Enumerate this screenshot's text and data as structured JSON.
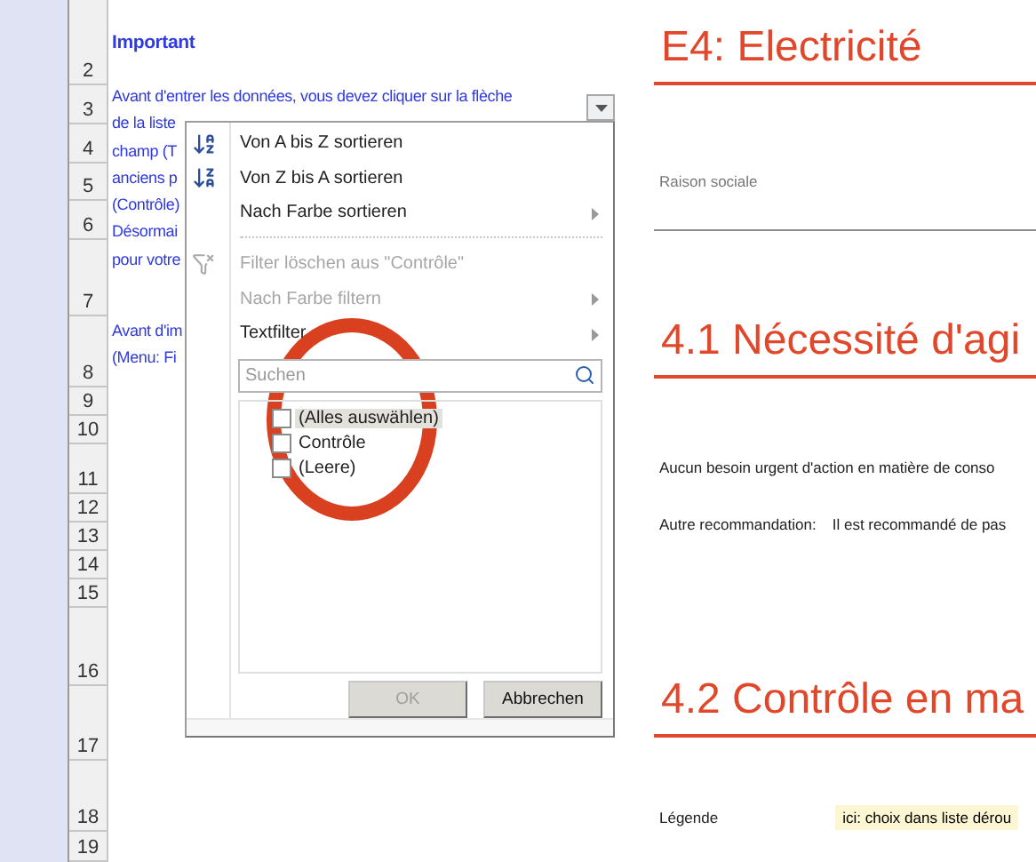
{
  "row_headers": [
    "2",
    "3",
    "4",
    "5",
    "6",
    "7",
    "8",
    "9",
    "10",
    "11",
    "12",
    "13",
    "14",
    "15",
    "16",
    "17",
    "18",
    "19"
  ],
  "notes": {
    "title": "Important",
    "block_1": [
      "Avant d'entrer les données, vous devez cliquer sur la flèche",
      "de la liste",
      "champ (T",
      "anciens p",
      "(Contrôle)",
      "Désormai",
      "pour votre"
    ],
    "block_2": [
      "Avant d'im",
      "(Menu: Fi"
    ]
  },
  "filter_menu": {
    "items": [
      {
        "label": "Von A bis Z sortieren",
        "kind": "sort_asc",
        "disabled": false,
        "submenu": false
      },
      {
        "label": "Von Z bis A sortieren",
        "kind": "sort_desc",
        "disabled": false,
        "submenu": false
      },
      {
        "label": "Nach Farbe sortieren",
        "kind": "plain",
        "disabled": false,
        "submenu": true
      },
      {
        "label": "Filter löschen aus \"Contrôle\"",
        "kind": "clear_filter",
        "disabled": true,
        "submenu": false
      },
      {
        "label": "Nach Farbe filtern",
        "kind": "plain",
        "disabled": true,
        "submenu": true
      },
      {
        "label": "Textfilter",
        "kind": "plain",
        "disabled": false,
        "submenu": true
      }
    ],
    "search": {
      "placeholder": "Suchen"
    },
    "values": [
      {
        "label": "(Alles auswählen)",
        "checked": false,
        "selected": true
      },
      {
        "label": "Contrôle",
        "checked": false,
        "selected": false
      },
      {
        "label": "(Leere)",
        "checked": false,
        "selected": false
      }
    ],
    "buttons": [
      {
        "label": "OK",
        "disabled": true
      },
      {
        "label": "Abbrechen",
        "disabled": false
      }
    ]
  },
  "report": {
    "title": "E4: Electricité",
    "company_label": "Raison sociale",
    "section_1": "4.1 Nécessité d'agi",
    "summary": "Aucun besoin urgent d'action en matière de conso",
    "recommendation_label": "Autre recommandation:",
    "recommendation": "Il est recommandé de pas",
    "section_2": "4.2 Contrôle en ma",
    "legend_label": "Légende",
    "legend_value": "ici: choix dans liste dérou"
  }
}
